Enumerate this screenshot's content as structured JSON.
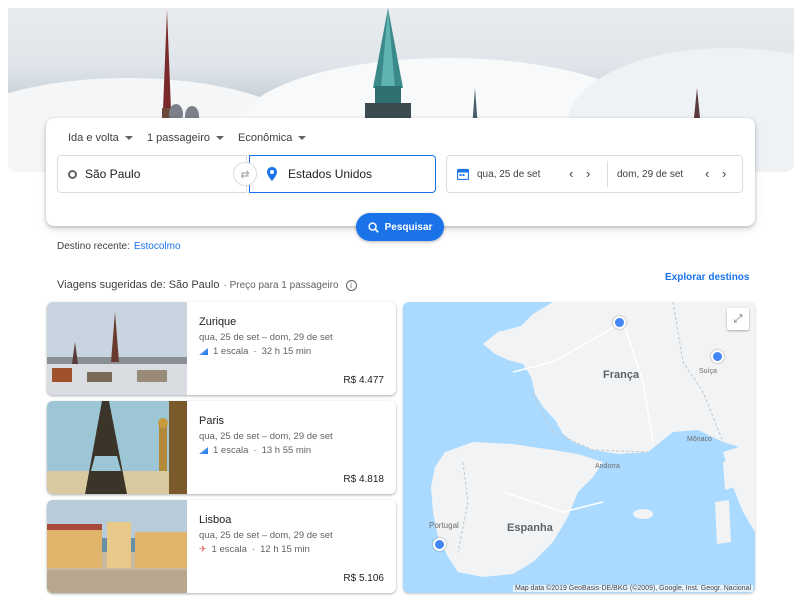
{
  "search": {
    "trip_type": "Ida e volta",
    "passengers": "1 passageiro",
    "cabin": "Econômica",
    "origin": "São Paulo",
    "destination": "Estados Unidos",
    "depart": "qua, 25 de set",
    "return": "dom, 29 de set",
    "search_label": "Pesquisar"
  },
  "recent": {
    "label": "Destino recente:",
    "link": "Estocolmo"
  },
  "suggestions": {
    "title": "Viagens sugeridas de: São Paulo",
    "subtitle": "· Preço para 1 passageiro",
    "explore": "Explorar destinos"
  },
  "trips": [
    {
      "city": "Zurique",
      "dates": "qua, 25 de set – dom, 29 de set",
      "stops": "1 escala",
      "duration": "32 h 15 min",
      "price": "R$ 4.477"
    },
    {
      "city": "Paris",
      "dates": "qua, 25 de set – dom, 29 de set",
      "stops": "1 escala",
      "duration": "13 h 55 min",
      "price": "R$ 4.818"
    },
    {
      "city": "Lisboa",
      "dates": "qua, 25 de set – dom, 29 de set",
      "stops": "1 escala",
      "duration": "12 h 15 min",
      "price": "R$ 5.106"
    }
  ],
  "map": {
    "labels": {
      "france": "França",
      "spain": "Espanha",
      "portugal": "Portugal",
      "switzerland": "Suíça",
      "andorra": "Andorra",
      "monaco": "Mônaco"
    },
    "attribution": "Map data ©2019 GeoBasis-DE/BKG (©2009), Google, Inst. Geogr. Nacional"
  },
  "colors": {
    "accent": "#1a73e8",
    "pin": "#4285f4",
    "sea": "#aadaff",
    "land": "#f1f3f4"
  }
}
